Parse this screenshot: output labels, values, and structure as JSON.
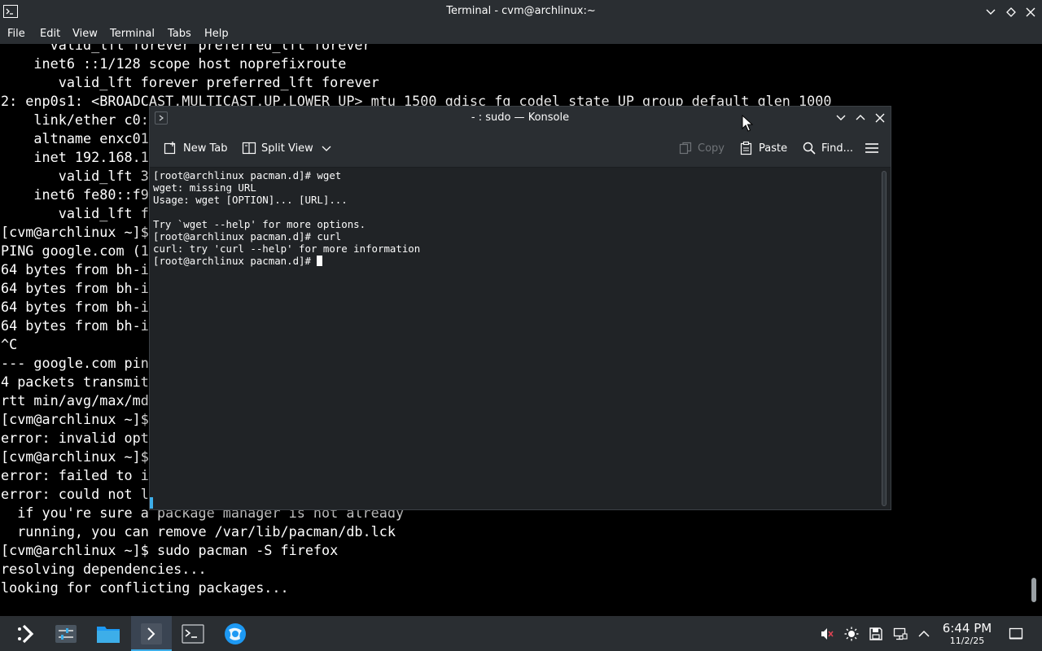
{
  "background_window": {
    "title": "Terminal - cvm@archlinux:~",
    "menu": [
      "File",
      "Edit",
      "View",
      "Terminal",
      "Tabs",
      "Help"
    ],
    "lines": [
      "      valid_lft forever preferred_lft forever",
      "    inet6 ::1/128 scope host noprefixroute",
      "       valid_lft forever preferred_lft forever",
      "2: enp0s1: <BROADCAST,MULTICAST,UP,LOWER_UP> mtu 1500 qdisc fq_codel state UP group default qlen 1000",
      "    link/ether c0:",
      "    altname enxc01",
      "    inet 192.168.1",
      "       valid_lft 3",
      "    inet6 fe80::f9",
      "       valid_lft fo",
      "[cvm@archlinux ~]$",
      "PING google.com (1",
      "64 bytes from bh-i",
      "64 bytes from bh-i",
      "64 bytes from bh-i",
      "64 bytes from bh-i",
      "^C",
      "--- google.com ping",
      "4 packets transmit",
      "rtt min/avg/max/md",
      "[cvm@archlinux ~]$",
      "error: invalid opt",
      "[cvm@archlinux ~]$",
      "error: failed to i",
      "error: could not l",
      "  if you're sure a package manager is not already",
      "  running, you can remove /var/lib/pacman/db.lck",
      "[cvm@archlinux ~]$ sudo pacman -S firefox",
      "resolving dependencies...",
      "looking for conflicting packages..."
    ]
  },
  "konsole": {
    "title": "- : sudo — Konsole",
    "toolbar": {
      "new_tab": "New Tab",
      "split_view": "Split View",
      "copy": "Copy",
      "paste": "Paste",
      "find": "Find..."
    },
    "lines": [
      "[root@archlinux pacman.d]# wget",
      "wget: missing URL",
      "Usage: wget [OPTION]... [URL]...",
      "",
      "Try `wget --help' for more options.",
      "[root@archlinux pacman.d]# curl",
      "curl: try 'curl --help' for more information",
      "[root@archlinux pacman.d]# "
    ]
  },
  "taskbar": {
    "apps": [
      "application-launcher-icon",
      "system-settings-icon",
      "file-manager-icon",
      "konsole-icon",
      "terminal-icon",
      "browser-icon"
    ],
    "tray": [
      "audio-muted-icon",
      "brightness-icon",
      "storage-icon",
      "network-icon",
      "tray-expand-icon"
    ],
    "time": "6:44 PM",
    "date": "11/2/25"
  },
  "colors": {
    "accent": "#3daee9",
    "panel": "#2a2e32",
    "konsole_bg": "#202326"
  }
}
